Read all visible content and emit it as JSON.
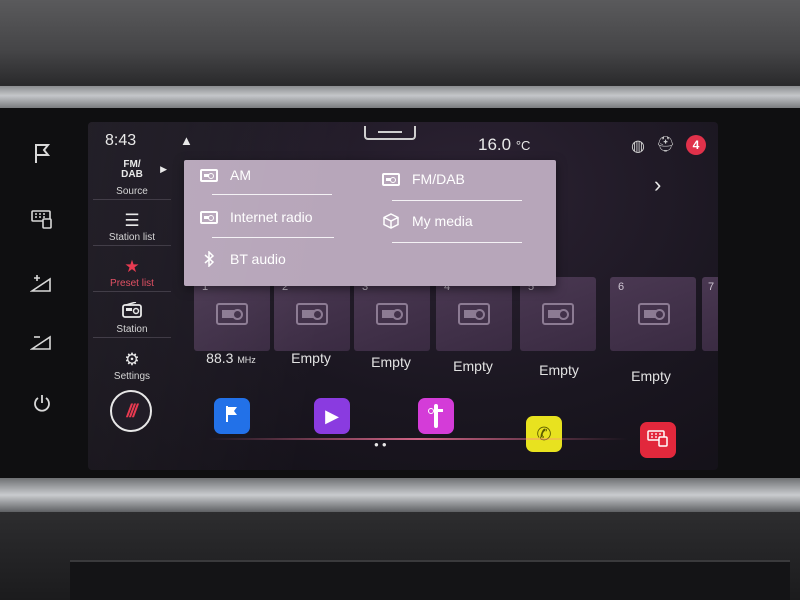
{
  "status": {
    "time": "8:43",
    "temperature": "16.0",
    "temperature_unit": "°C",
    "notification_count": "4"
  },
  "sidebar": {
    "source_icon_text": "FM/\nDAB",
    "items": [
      {
        "label": "Source",
        "icon": "source-icon"
      },
      {
        "label": "Station list",
        "icon": "list-icon"
      },
      {
        "label": "Preset list",
        "icon": "star-icon"
      },
      {
        "label": "Station",
        "icon": "radio-icon"
      },
      {
        "label": "Settings",
        "icon": "gear-icon"
      }
    ],
    "active": "Preset list"
  },
  "source_menu": {
    "items": [
      {
        "label": "AM",
        "icon": "radio-icon"
      },
      {
        "label": "FM/DAB",
        "icon": "radio-icon"
      },
      {
        "label": "Internet radio",
        "icon": "internet-radio-icon"
      },
      {
        "label": "My media",
        "icon": "cube-icon"
      },
      {
        "label": "BT audio",
        "icon": "bluetooth-icon"
      }
    ]
  },
  "presets": [
    {
      "number": "1",
      "label": "88.3",
      "unit": "MHz"
    },
    {
      "number": "2",
      "label": "Empty"
    },
    {
      "number": "3",
      "label": "Empty"
    },
    {
      "number": "4",
      "label": "Empty"
    },
    {
      "number": "5",
      "label": "Empty"
    },
    {
      "number": "6",
      "label": "Empty"
    },
    {
      "number": "7",
      "label": ""
    }
  ],
  "dock": [
    {
      "name": "navigation-app",
      "color": "#1f6fe8",
      "icon": "flag-icon"
    },
    {
      "name": "media-app",
      "color": "#8a3be0",
      "icon": "play-icon"
    },
    {
      "name": "radio-app",
      "color": "#d43cd8",
      "icon": "radio-icon"
    },
    {
      "name": "phone-app",
      "color": "#e8e21f",
      "icon": "phone-icon"
    },
    {
      "name": "car-app",
      "color": "#e2283c",
      "icon": "car-icon"
    }
  ],
  "accent_color": "#e8334a"
}
